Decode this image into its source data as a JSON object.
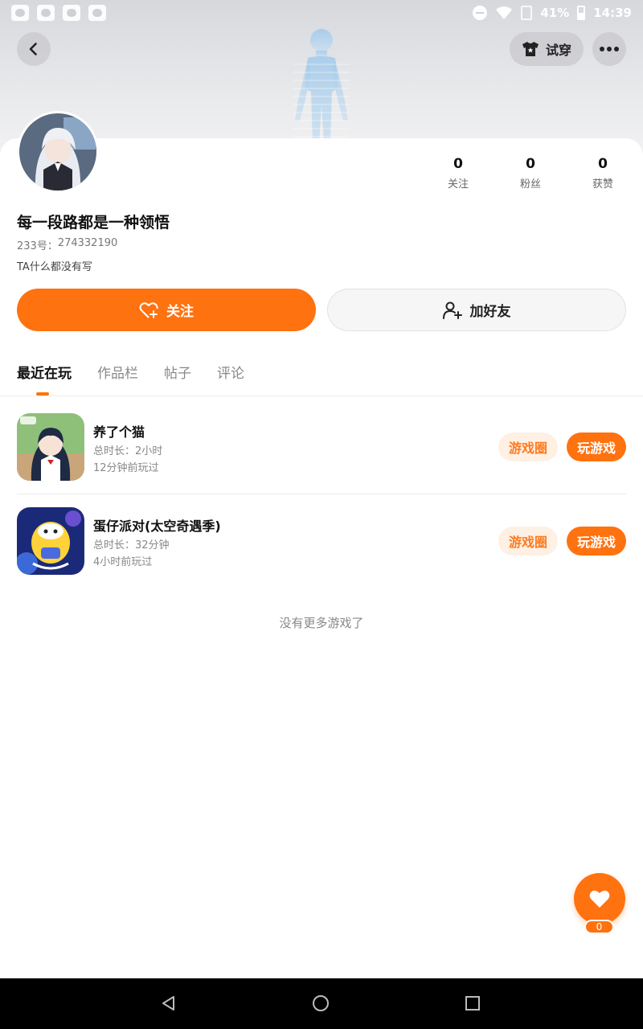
{
  "status_bar": {
    "battery": "41%",
    "time": "14:39"
  },
  "header": {
    "tryon_label": "试穿",
    "back_icon": "chevron-left-icon",
    "more_icon": "more-dots-icon"
  },
  "profile": {
    "stats": [
      {
        "value": "0",
        "label": "关注"
      },
      {
        "value": "0",
        "label": "粉丝"
      },
      {
        "value": "0",
        "label": "获赞"
      }
    ],
    "nickname": "每一段路都是一种领悟",
    "uid_label": "233号：",
    "uid_value": "274332190",
    "bio": "TA什么都没有写"
  },
  "actions": {
    "follow_label": "关注",
    "add_friend_label": "加好友"
  },
  "tabs": [
    {
      "label": "最近在玩",
      "active": true
    },
    {
      "label": "作品栏",
      "active": false
    },
    {
      "label": "帖子",
      "active": false
    },
    {
      "label": "评论",
      "active": false
    }
  ],
  "games": [
    {
      "name": "养了个猫",
      "duration_label": "总时长：",
      "duration_value": "2小时",
      "last_played": "12分钟前玩过",
      "circle_label": "游戏圈",
      "play_label": "玩游戏"
    },
    {
      "name": "蛋仔派对(太空奇遇季)",
      "duration_label": "总时长：",
      "duration_value": "32分钟",
      "last_played": "4小时前玩过",
      "circle_label": "游戏圈",
      "play_label": "玩游戏"
    }
  ],
  "no_more_text": "没有更多游戏了",
  "like_fab": {
    "count": "0"
  },
  "colors": {
    "accent": "#ff7210",
    "accent_light": "#fff0e4"
  }
}
